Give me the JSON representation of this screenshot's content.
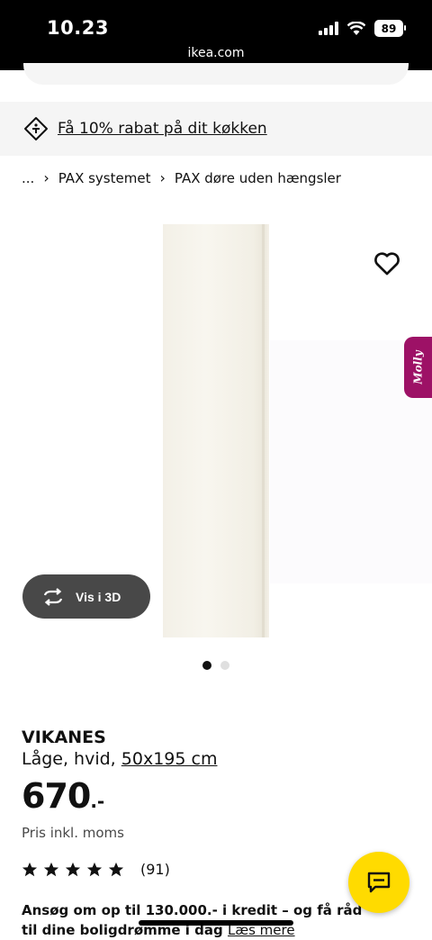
{
  "status_bar": {
    "time": "10.23",
    "url": "ikea.com",
    "battery": "89",
    "icons": [
      "signal-icon",
      "wifi-icon",
      "battery-icon"
    ]
  },
  "promo": {
    "text": "Få 10% rabat på dit køkken",
    "icon": "tag-icon"
  },
  "breadcrumb": {
    "items": [
      "...",
      "PAX systemet",
      "PAX døre uden hængsler"
    ]
  },
  "gallery": {
    "view_3d_label": "Vis i 3D",
    "molly_label": "Molly",
    "page_count": 2,
    "active_page": 1
  },
  "product": {
    "name": "VIKANES",
    "description": "Låge, hvid,",
    "dimensions": "50x195 cm",
    "price": "670",
    "price_suffix": ".-",
    "price_note": "Pris inkl. moms",
    "rating_stars": 5,
    "rating_count": "(91)"
  },
  "credit": {
    "text": "Ansøg om op til 130.000.- i kredit – og få råd til dine boligdrømme i dag",
    "link": "Læs mere"
  },
  "colors": {
    "accent": "#ffdb00",
    "molly": "#9d1166",
    "button_dark": "#484848"
  }
}
